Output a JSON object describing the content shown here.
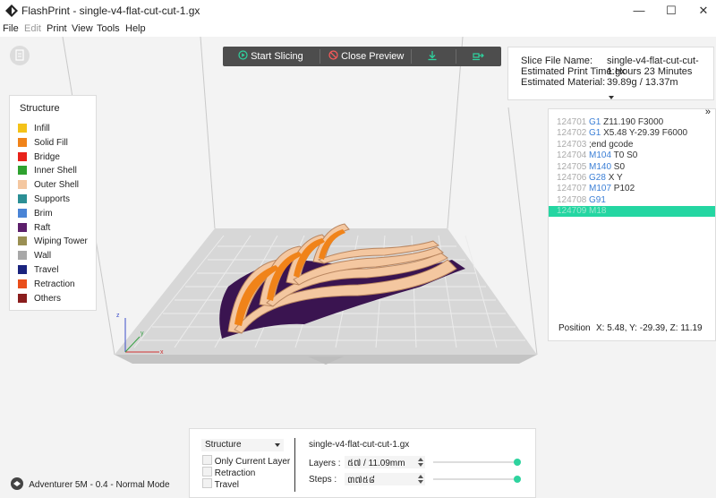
{
  "window": {
    "title": "FlashPrint - single-v4-flat-cut-cut-1.gx",
    "controls": [
      "—",
      "☐",
      "✕"
    ]
  },
  "menu": [
    "File",
    "Edit",
    "Print",
    "View",
    "Tools",
    "Help"
  ],
  "toolbar": {
    "start_slicing": "Start Slicing",
    "close_preview": "Close Preview"
  },
  "slice_info": {
    "file_name_label": "Slice File Name:",
    "file_name_value": "single-v4-flat-cut-cut-1.gx",
    "print_time_label": "Estimated Print Time:",
    "print_time_value": "1 Hours 23 Minutes",
    "material_label": "Estimated Material:",
    "material_value": "39.89g / 13.37m"
  },
  "legend": {
    "title": "Structure",
    "items": [
      {
        "label": "Infill",
        "color": "#f4c218"
      },
      {
        "label": "Solid Fill",
        "color": "#f08319"
      },
      {
        "label": "Bridge",
        "color": "#e8221a"
      },
      {
        "label": "Inner Shell",
        "color": "#2ea12f"
      },
      {
        "label": "Outer Shell",
        "color": "#f4c7a0"
      },
      {
        "label": "Supports",
        "color": "#2b8f95"
      },
      {
        "label": "Brim",
        "color": "#4a84d6"
      },
      {
        "label": "Raft",
        "color": "#5c1f6b"
      },
      {
        "label": "Wiping Tower",
        "color": "#9a8f53"
      },
      {
        "label": "Wall",
        "color": "#a8a8a8"
      },
      {
        "label": "Travel",
        "color": "#1a237e"
      },
      {
        "label": "Retraction",
        "color": "#e94e1b"
      },
      {
        "label": "Others",
        "color": "#8a1d1d"
      }
    ]
  },
  "gcode": {
    "collapse": "»",
    "lines": [
      {
        "num": "124701",
        "cmd": "G1",
        "args": "Z11.190 F3000"
      },
      {
        "num": "124702",
        "cmd": "G1",
        "args": "X5.48 Y-29.39 F6000"
      },
      {
        "num": "124703",
        "cmd": "",
        "args": ";end gcode"
      },
      {
        "num": "124704",
        "cmd": "M104",
        "args": "T0 S0"
      },
      {
        "num": "124705",
        "cmd": "M140",
        "args": "S0"
      },
      {
        "num": "124706",
        "cmd": "G28",
        "args": "X Y"
      },
      {
        "num": "124707",
        "cmd": "M107",
        "args": "P102"
      },
      {
        "num": "124708",
        "cmd": "G91",
        "args": ""
      },
      {
        "num": "124709",
        "cmd": "M18",
        "args": ""
      }
    ],
    "position_label": "Position",
    "position_value": "X: 5.48, Y: -29.39, Z: 11.19"
  },
  "bottom": {
    "view_select": "Structure",
    "only_current_layer": "Only Current Layer",
    "retraction": "Retraction",
    "travel": "Travel",
    "filename": "single-v4-flat-cut-cut-1.gx",
    "layers_label": "Layers :",
    "layers_value": "៥៧ / 11.09mm",
    "steps_label": "Steps :",
    "steps_value": "៣៧៥៨",
    "layers_slider": 1.0,
    "steps_slider": 1.0
  },
  "status": {
    "machine": "Adventurer 5M - 0.4 - Normal Mode"
  },
  "axes": {
    "z": "z",
    "y": "y",
    "x": "x"
  }
}
